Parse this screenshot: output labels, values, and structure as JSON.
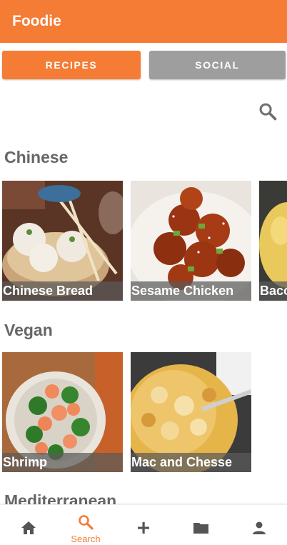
{
  "app": {
    "title": "Foodie",
    "accent_color": "#f57c35",
    "inactive_color": "#9e9e9e"
  },
  "tabs": [
    {
      "label": "RECIPES",
      "active": true
    },
    {
      "label": "SOCIAL",
      "active": false
    }
  ],
  "search": {
    "icon": "search-icon"
  },
  "sections": [
    {
      "title": "Chinese",
      "cards": [
        {
          "label": "Chinese Bread"
        },
        {
          "label": "Sesame Chicken"
        },
        {
          "label": "Bacon"
        }
      ]
    },
    {
      "title": "Vegan",
      "cards": [
        {
          "label": "Shrimp"
        },
        {
          "label": "Mac and Chesse"
        }
      ]
    },
    {
      "title": "Mediterranean",
      "cards": []
    }
  ],
  "bottom_nav": [
    {
      "icon": "home-icon",
      "label": ""
    },
    {
      "icon": "search-icon",
      "label": "Search",
      "active": true
    },
    {
      "icon": "add-icon",
      "label": ""
    },
    {
      "icon": "folder-icon",
      "label": ""
    },
    {
      "icon": "person-icon",
      "label": ""
    }
  ]
}
